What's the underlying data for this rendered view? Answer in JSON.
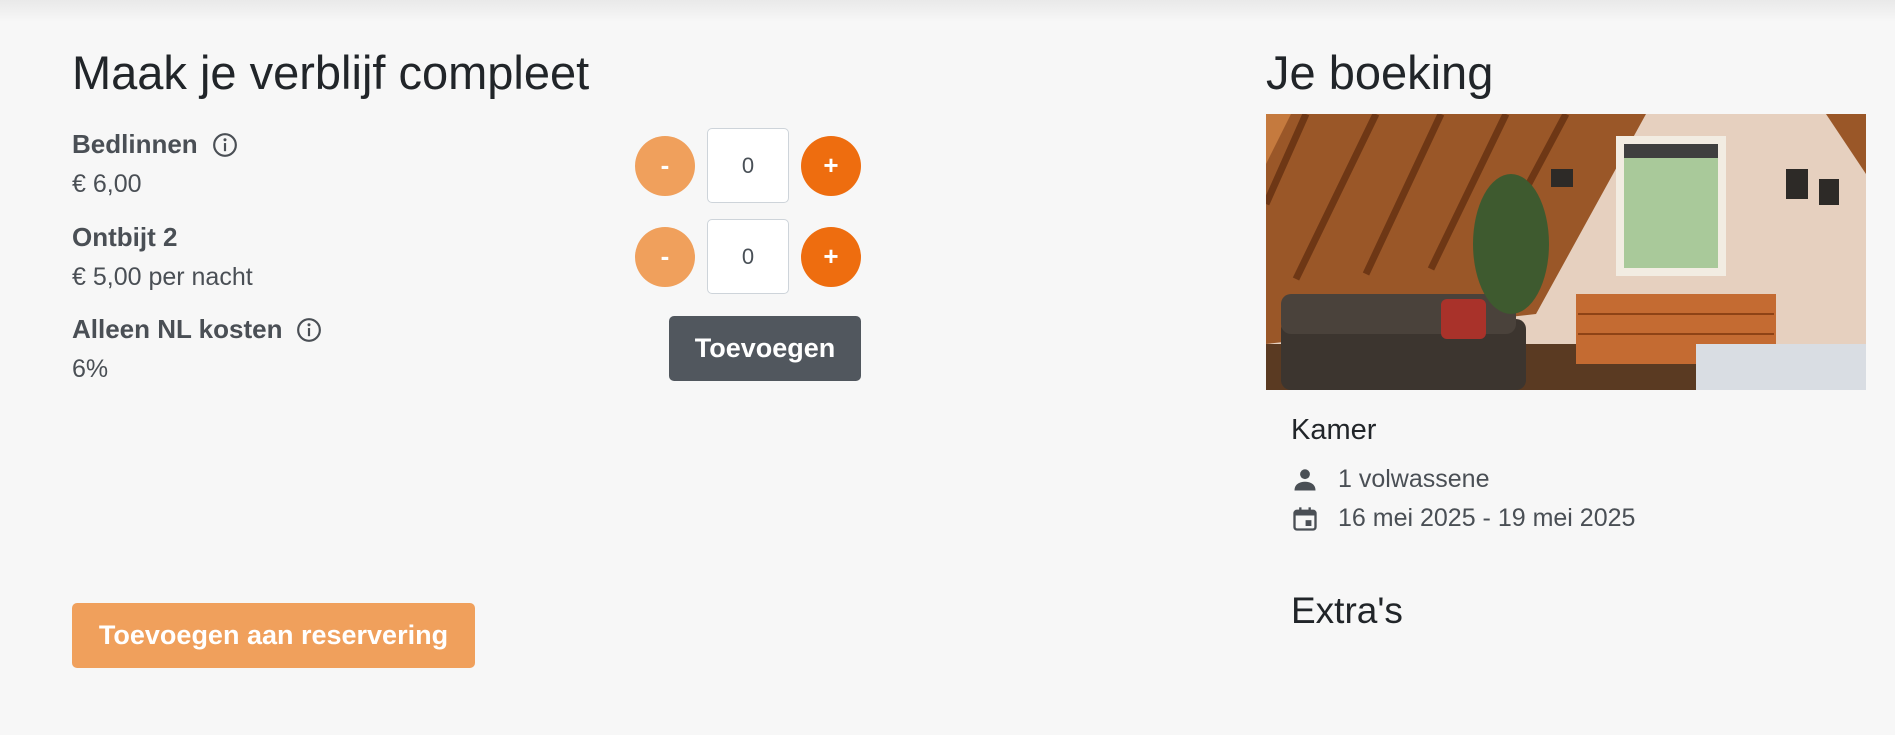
{
  "left": {
    "title": "Maak je verblijf compleet",
    "extras": [
      {
        "name": "Bedlinnen",
        "price": "€ 6,00",
        "has_info": true,
        "quantity": "0"
      },
      {
        "name": "Ontbijt 2",
        "price": "€ 5,00 per nacht",
        "has_info": false,
        "quantity": "0"
      },
      {
        "name": "Alleen NL kosten",
        "price": "6%",
        "has_info": true
      }
    ],
    "minus_label": "-",
    "plus_label": "+",
    "add_button": "Toevoegen",
    "submit_button": "Toevoegen aan reservering"
  },
  "booking": {
    "title": "Je boeking",
    "room": "Kamer",
    "guests": "1 volwassene",
    "dates": "16 mei 2025 - 19 mei 2025",
    "extras_title": "Extra's"
  },
  "icons": {
    "info": "info-circle-icon",
    "guests": "person-icon",
    "dates": "calendar-icon"
  },
  "colors": {
    "primary_orange": "#ee6d0f",
    "light_orange": "#f0a05c",
    "dark_button": "#51575e",
    "background": "#f7f7f7"
  }
}
